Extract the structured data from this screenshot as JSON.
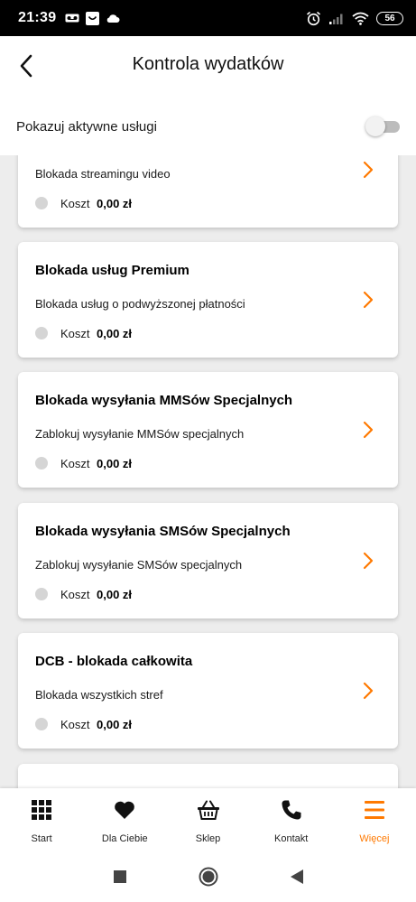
{
  "status_bar": {
    "time": "21:39",
    "battery": "56"
  },
  "header": {
    "title": "Kontrola wydatków",
    "back_icon": "chevron-left-icon"
  },
  "toggle_row": {
    "label": "Pokazuj aktywne usługi",
    "checked": false
  },
  "cards": [
    {
      "title": "",
      "description": "Blokada streamingu video",
      "cost_label": "Koszt",
      "cost_value": "0,00 zł"
    },
    {
      "title": "Blokada usług Premium",
      "description": "Blokada usług o podwyższonej płatności",
      "cost_label": "Koszt",
      "cost_value": "0,00 zł"
    },
    {
      "title": "Blokada wysyłania MMSów Specjalnych",
      "description": "Zablokuj wysyłanie MMSów specjalnych",
      "cost_label": "Koszt",
      "cost_value": "0,00 zł"
    },
    {
      "title": "Blokada wysyłania SMSów Specjalnych",
      "description": "Zablokuj wysyłanie SMSów specjalnych",
      "cost_label": "Koszt",
      "cost_value": "0,00 zł"
    },
    {
      "title": "DCB - blokada całkowita",
      "description": "Blokada wszystkich stref",
      "cost_label": "Koszt",
      "cost_value": "0,00 zł"
    }
  ],
  "bottom_nav": {
    "items": [
      {
        "label": "Start",
        "icon": "grid-icon"
      },
      {
        "label": "Dla Ciebie",
        "icon": "heart-icon"
      },
      {
        "label": "Sklep",
        "icon": "basket-icon"
      },
      {
        "label": "Kontakt",
        "icon": "phone-icon"
      },
      {
        "label": "Więcej",
        "icon": "menu-icon"
      }
    ],
    "active": "Więcej"
  },
  "colors": {
    "accent": "#ff7900",
    "list_background": "#ededed"
  }
}
